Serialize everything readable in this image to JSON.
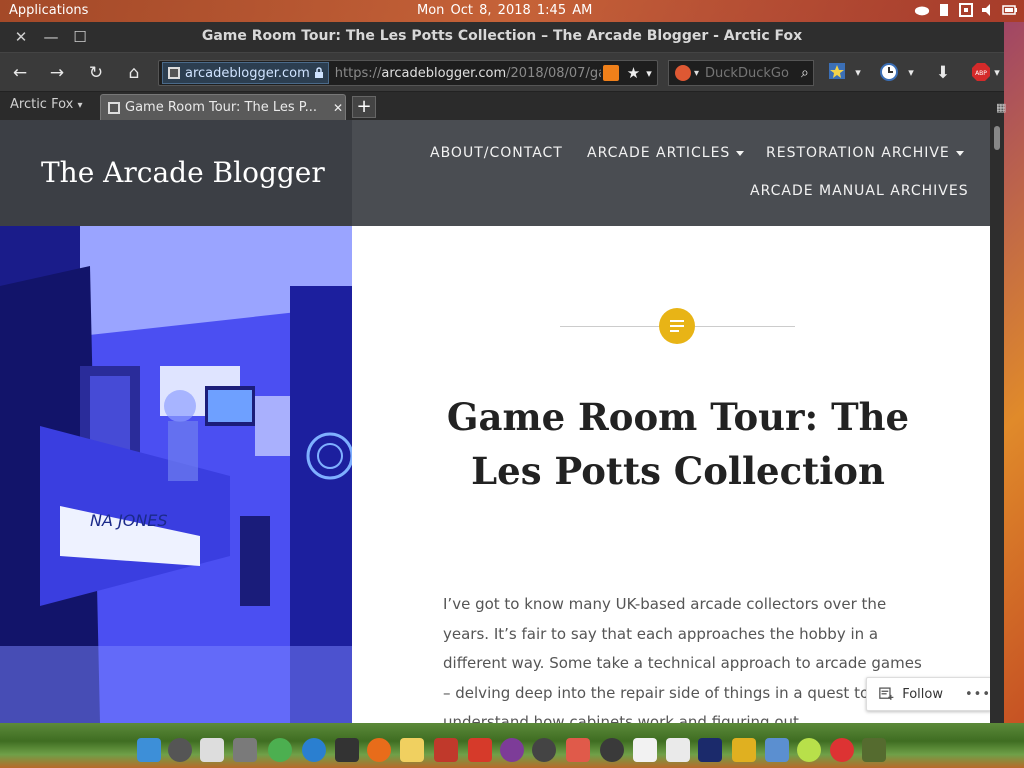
{
  "system_panel": {
    "applications_label": "Applications",
    "clock": "Mon Oct  8, 2018    1:45 AM",
    "tray_icons": [
      "cloud-icon",
      "clipboard-icon",
      "network-icon",
      "volume-icon",
      "battery-icon"
    ]
  },
  "window": {
    "title": "Game Room Tour: The Les Potts Collection – The Arcade Blogger - Arctic Fox",
    "controls": [
      "close-icon",
      "minimize-icon",
      "maximize-icon"
    ]
  },
  "navbar": {
    "site_identity": "arcadeblogger.com",
    "url_scheme": "https://",
    "url_host": "arcadeblogger.com",
    "url_path": "/2018/08/07/ga",
    "search_placeholder": "DuckDuckGo"
  },
  "tabs": {
    "group_label": "Arctic Fox",
    "active_tab_label": "Game Room Tour: The Les P..."
  },
  "site": {
    "title": "The Arcade Blogger",
    "nav": [
      {
        "label": "ABOUT/CONTACT",
        "has_dropdown": false
      },
      {
        "label": "ARCADE ARTICLES",
        "has_dropdown": true
      },
      {
        "label": "RESTORATION ARCHIVE",
        "has_dropdown": true
      },
      {
        "label": "ARCADE MANUAL ARCHIVES",
        "has_dropdown": false
      }
    ]
  },
  "post": {
    "title": "Game Room Tour: The Les Potts Collection",
    "body": "I’ve got to know many UK-based arcade collectors over the years. It’s fair to say that each approaches the hobby in a different way. Some take a technical approach to arcade games – delving deep into the repair side of things in a quest to understand how cabinets work and figuring out",
    "badge_color": "#e8b416"
  },
  "follow": {
    "label": "Follow",
    "more_label": "•••"
  },
  "colors": {
    "header_left": "#3c3f45",
    "header_right": "#4a4d52",
    "accent": "#e8b416"
  }
}
